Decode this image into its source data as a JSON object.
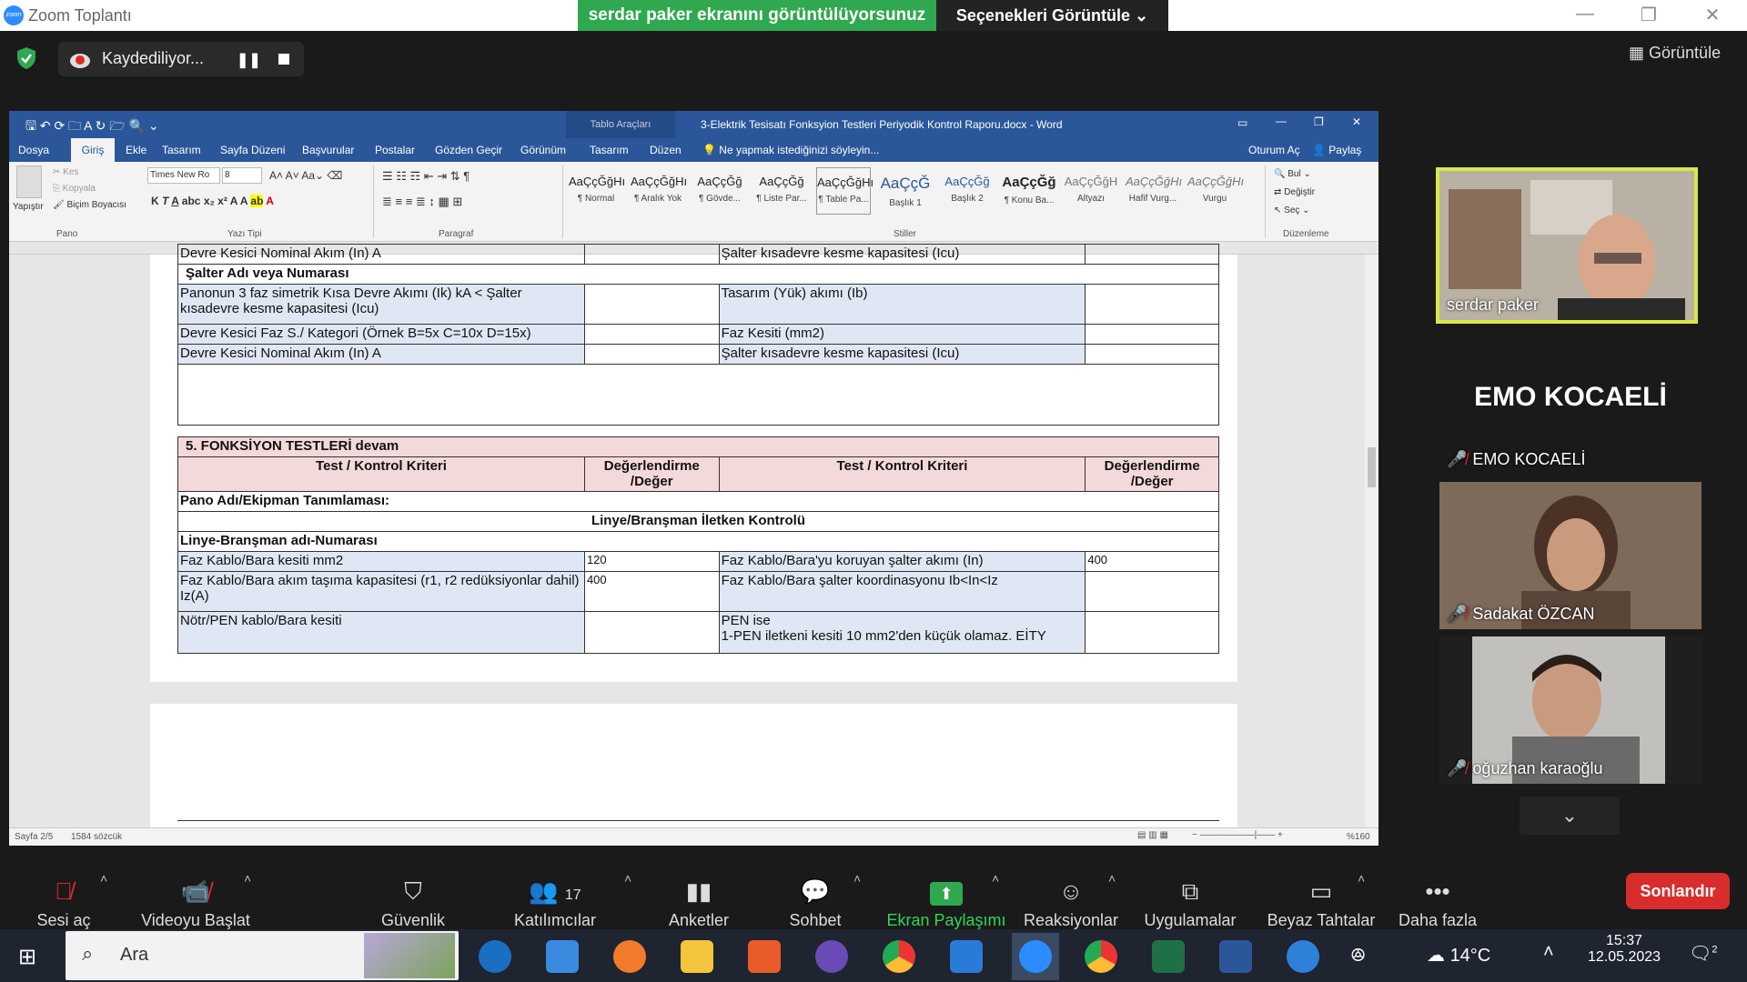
{
  "zoom": {
    "window_title": "Zoom Toplantı",
    "logo_text": "zoom",
    "share_banner": "serdar paker ekranını görüntülüyorsunuz",
    "view_options": "Seçenekleri Görüntüle",
    "recording_label": "Kaydediliyor...",
    "view_button": "Görüntüle"
  },
  "word": {
    "title": "3-Elektrik Tesisatı Fonksyion Testleri Periyodik Kontrol Raporu.docx - Word",
    "table_tools": "Tablo Araçları",
    "signin": "Oturum Aç",
    "share": "Paylaş",
    "tell_me": "Ne yapmak istediğinizi söyleyin...",
    "tabs": [
      "Dosya",
      "Giriş",
      "Ekle",
      "Tasarım",
      "Sayfa Düzeni",
      "Başvurular",
      "Postalar",
      "Gözden Geçir",
      "Görünüm",
      "Tasarım",
      "Düzen"
    ],
    "ribbon": {
      "paste": "Yapıştır",
      "cut": "Kes",
      "copy": "Kopyala",
      "format_painter": "Biçim Boyacısı",
      "font_name": "Times New Ro",
      "font_size": "8",
      "groups": [
        "Pano",
        "Yazı Tipi",
        "Paragraf",
        "Stiller",
        "Düzenleme"
      ],
      "find": "Bul",
      "replace": "Değiştir",
      "select": "Seç",
      "styles": [
        {
          "sample": "AaÇçĞğHı",
          "name": "¶ Normal"
        },
        {
          "sample": "AaÇçĞğHı",
          "name": "¶ Aralık Yok"
        },
        {
          "sample": "AaÇçĞğ",
          "name": "¶ Gövde..."
        },
        {
          "sample": "AaÇçĞğ",
          "name": "¶ Liste Par..."
        },
        {
          "sample": "AaÇçĞğHı",
          "name": "¶ Table Pa..."
        },
        {
          "sample": "AaÇçĞ",
          "name": "Başlık 1"
        },
        {
          "sample": "AaÇçĞğ",
          "name": "Başlık 2"
        },
        {
          "sample": "AaÇçĞğ",
          "name": "¶ Konu Ba..."
        },
        {
          "sample": "AaÇçĞğH",
          "name": "Altyazı"
        },
        {
          "sample": "AaÇçĞğHı",
          "name": "Hafif Vurg..."
        },
        {
          "sample": "AaÇçĞğHı",
          "name": "Vurgu"
        }
      ]
    },
    "doc": {
      "cut_row_left": "Devre Kesici Nominal Akım (In) A",
      "cut_row_right": "Şalter kısadevre kesme kapasitesi (Icu)",
      "salter_header": "Şalter Adı veya Numarası",
      "rows1": [
        {
          "left": "Panonun 3 faz simetrik Kısa Devre Akımı (Ik) kA < Şalter kısadevre kesme kapasitesi (Icu)",
          "right": "Tasarım (Yük) akımı (Ib)"
        },
        {
          "left": "Devre Kesici Faz S./ Kategori (Örnek B=5x C=10x D=15x)",
          "right": "Faz Kesiti (mm2)"
        },
        {
          "left": "Devre Kesici Nominal Akım (In) A",
          "right": "Şalter kısadevre kesme kapasitesi (Icu)"
        }
      ],
      "section_title": "5. FONKSİYON TESTLERİ devam",
      "col_criteria": "Test / Kontrol Kriteri",
      "col_eval": "Değerlendirme /Değer",
      "pano_label": "Pano Adı/Ekipman Tanımlaması:",
      "linye_title": "Linye/Branşman İletken Kontrolü",
      "linye_label": "Linye-Branşman adı-Numarası",
      "rows2": [
        {
          "left": "Faz Kablo/Bara kesiti mm2",
          "lval": "120",
          "right": "Faz Kablo/Bara'yu koruyan şalter akımı (In)",
          "rval": "400"
        },
        {
          "left": "Faz Kablo/Bara akım taşıma kapasitesi (r1, r2 redüksiyonlar dahil) Iz(A)",
          "lval": "400",
          "right": "Faz Kablo/Bara şalter koordinasyonu   Ib<In<Iz",
          "rval": ""
        },
        {
          "left": "Nötr/PEN  kablo/Bara kesiti",
          "lval": "",
          "right": "PEN ise\n1-PEN iletkeni kesiti 10 mm2'den küçük olamaz. EİTY",
          "rval": ""
        }
      ]
    },
    "status": {
      "page": "Sayfa 2/5",
      "words": "1584 sözcük",
      "zoom": "%160"
    }
  },
  "participants": [
    {
      "name": "serdar paker",
      "muted": false,
      "video": true
    },
    {
      "name": "EMO KOCAELİ",
      "muted": true,
      "video": false,
      "display": "EMO KOCAELİ"
    },
    {
      "name": "Sadakat ÖZCAN",
      "muted": true,
      "video": true
    },
    {
      "name": "oğuzhan karaoğlu",
      "muted": true,
      "video": true
    }
  ],
  "toolbar": {
    "mute": "Sesi aç",
    "video": "Videoyu Başlat",
    "security": "Güvenlik",
    "participants": "Katılımcılar",
    "participant_count": "17",
    "polls": "Anketler",
    "chat": "Sohbet",
    "share": "Ekran Paylaşımı",
    "reactions": "Reaksiyonlar",
    "apps": "Uygulamalar",
    "whiteboards": "Beyaz Tahtalar",
    "more": "Daha fazla",
    "end": "Sonlandır"
  },
  "taskbar": {
    "search": "Ara",
    "weather": "14°C",
    "time": "15:37",
    "date": "12.05.2023",
    "notif_count": "2"
  },
  "colors": {
    "share_green": "#2fa84f",
    "word_blue": "#2b579a",
    "end_red": "#d92c2c",
    "speaker_border": "#d9e84a"
  }
}
